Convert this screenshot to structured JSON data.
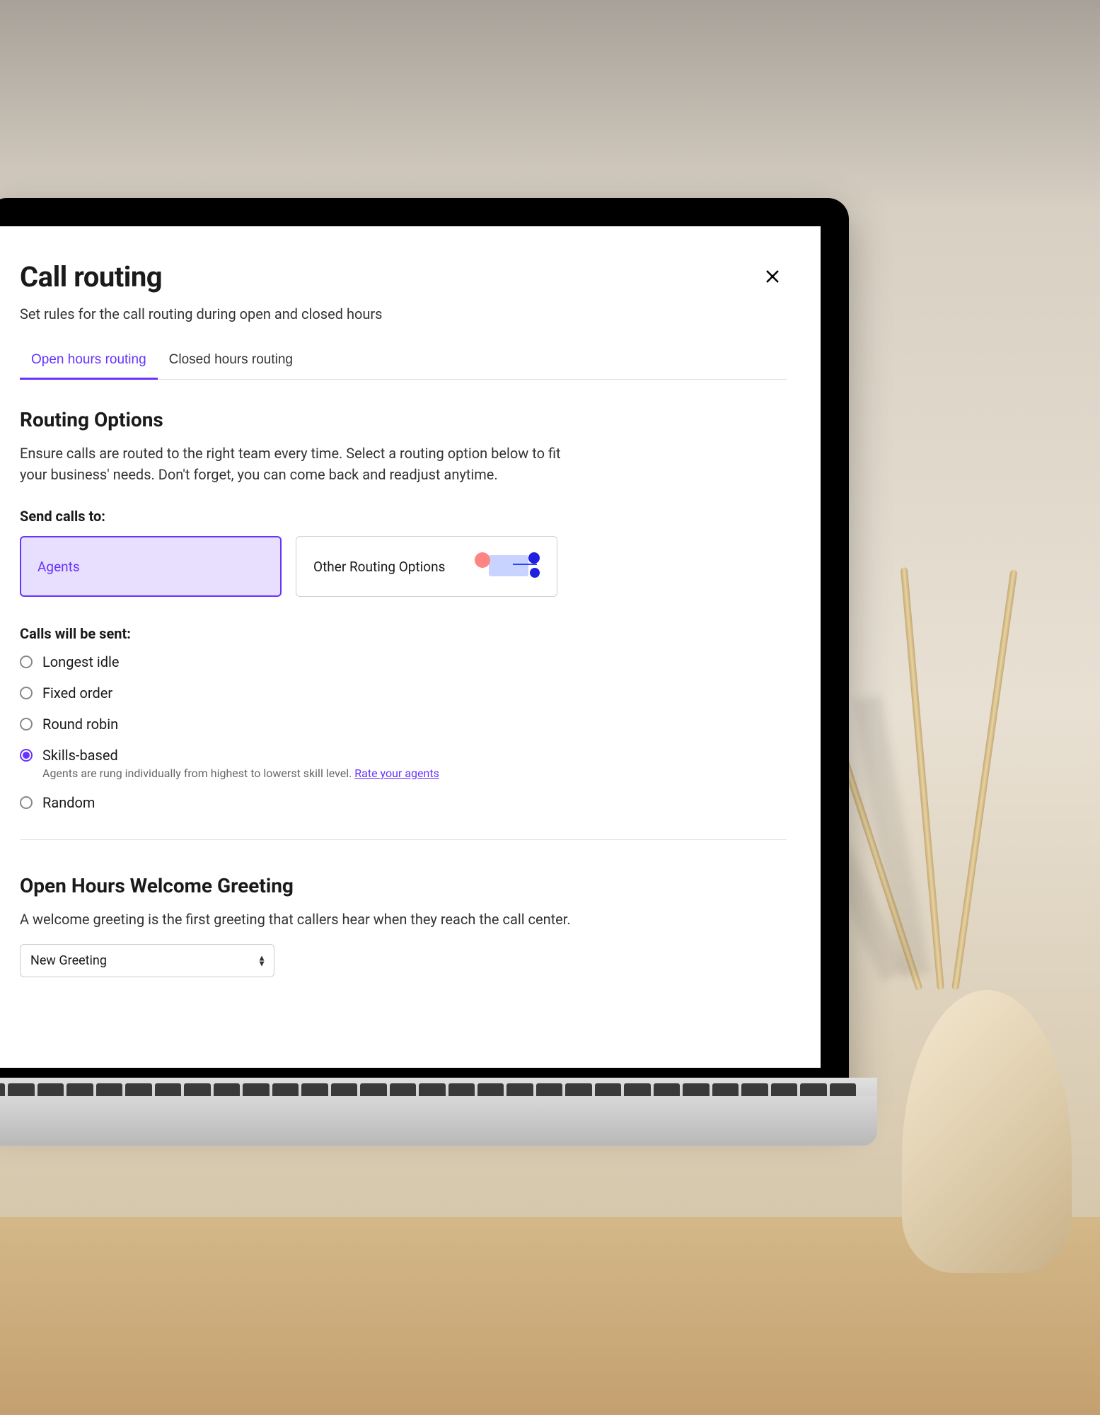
{
  "header": {
    "title": "Call routing",
    "subtitle": "Set rules for the call routing during open and closed hours"
  },
  "tabs": [
    {
      "label": "Open hours routing",
      "active": true
    },
    {
      "label": "Closed hours routing",
      "active": false
    }
  ],
  "routing_section": {
    "title": "Routing Options",
    "description": "Ensure calls are routed to the right team every time. Select a routing option below to fit your business' needs. Don't forget, you can come back and readjust anytime.",
    "send_calls_label": "Send calls to:",
    "options": [
      {
        "label": "Agents",
        "selected": true
      },
      {
        "label": "Other Routing Options",
        "selected": false
      }
    ],
    "calls_sent_label": "Calls will be sent:",
    "radio_options": [
      {
        "label": "Longest idle",
        "selected": false
      },
      {
        "label": "Fixed order",
        "selected": false
      },
      {
        "label": "Round robin",
        "selected": false
      },
      {
        "label": "Skills-based",
        "selected": true,
        "sublabel": "Agents are rung individually from highest to lowerst skill level.",
        "link_text": "Rate your agents"
      },
      {
        "label": "Random",
        "selected": false
      }
    ]
  },
  "greeting_section": {
    "title": "Open Hours Welcome Greeting",
    "description": "A welcome greeting is the first greeting that callers hear when they reach the call center.",
    "select_value": "New Greeting"
  },
  "colors": {
    "accent": "#6733ff",
    "accent_bg": "#e8dfff"
  }
}
